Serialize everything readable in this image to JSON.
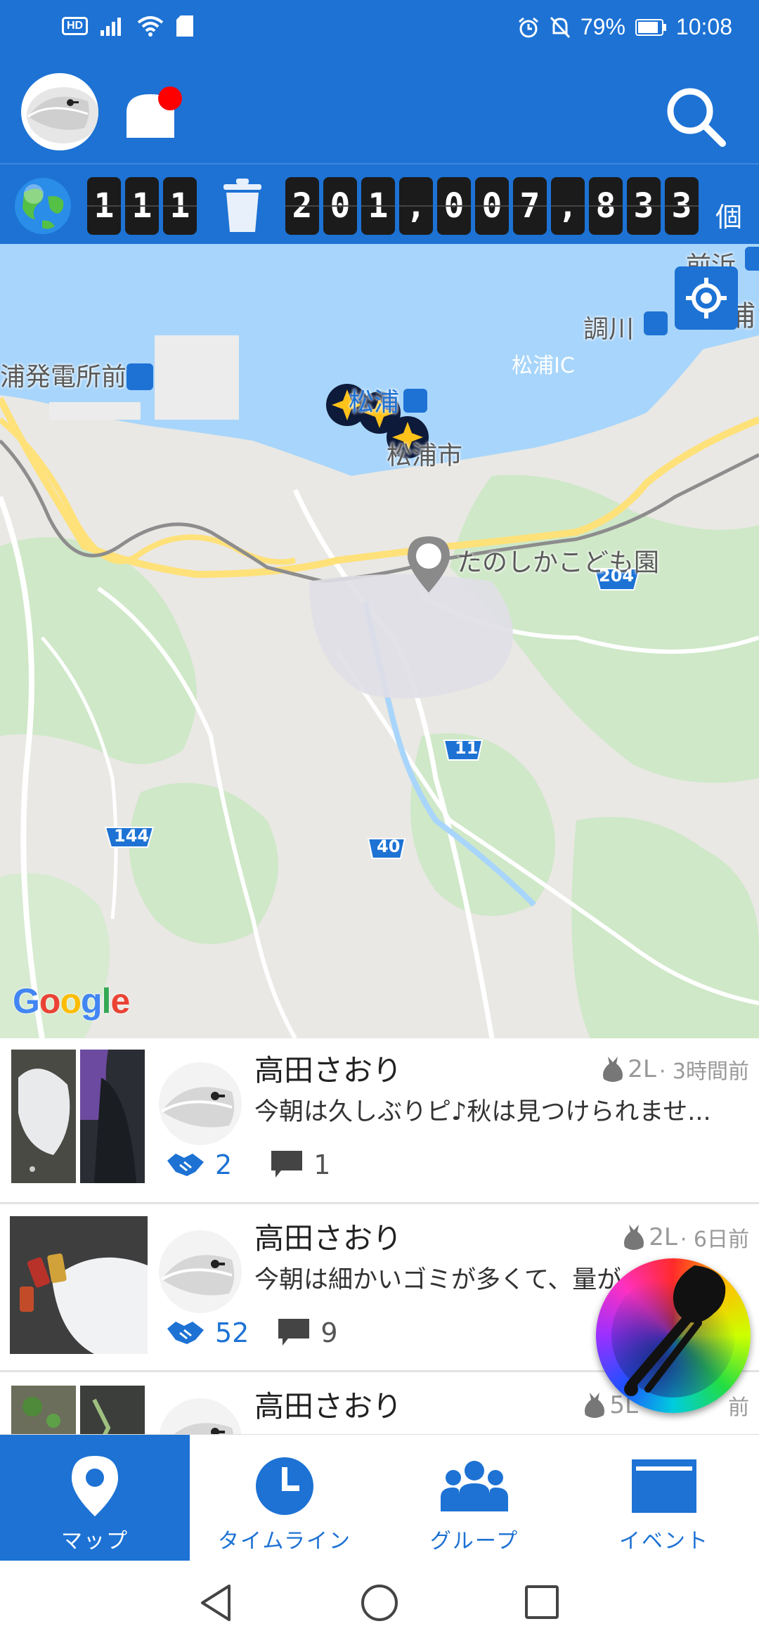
{
  "status_bar": {
    "hd": "HD",
    "battery_percent": "79%",
    "time": "10:08"
  },
  "counter": {
    "left_digits": [
      "1",
      "1",
      "1"
    ],
    "right_digits": [
      "2",
      "0",
      "1",
      ",",
      "0",
      "0",
      "7",
      ",",
      "8",
      "3",
      "3"
    ],
    "unit": "個"
  },
  "map": {
    "labels": {
      "maehama": "前浜",
      "matsuura_top": "松浦",
      "choukawa": "調川",
      "power_station": "浦発電所前",
      "matsuura_ic": "松浦IC",
      "matsuura_station": "松浦",
      "matsuura_city": "松浦市",
      "kindergarten": "たのしかこども園",
      "route_204": "204",
      "route_11": "11",
      "route_144": "144",
      "route_40": "40"
    },
    "attribution": "Google",
    "brand_colors": [
      "#4285F4",
      "#EA4335",
      "#FBBC05",
      "#4285F4",
      "#34A853",
      "#EA4335"
    ]
  },
  "posts": [
    {
      "name": "高田さおり",
      "volume": "2L",
      "time": "· 3時間前",
      "text": "今朝は久しぶりピ♪秋は見つけられませ...",
      "cheers": "2",
      "comments": "1"
    },
    {
      "name": "高田さおり",
      "volume": "2L",
      "time": "· 6日前",
      "text": "今朝は細かいゴミが多くて、量が",
      "cheers": "52",
      "comments": "9"
    },
    {
      "name": "高田さおり",
      "volume": "5L",
      "time": "前",
      "text": "",
      "cheers": "",
      "comments": ""
    }
  ],
  "nav": {
    "map": "マップ",
    "timeline": "タイムライン",
    "group": "グループ",
    "event": "イベント"
  },
  "colors": {
    "primary": "#1d72d4",
    "notification_dot": "#ff0000"
  }
}
